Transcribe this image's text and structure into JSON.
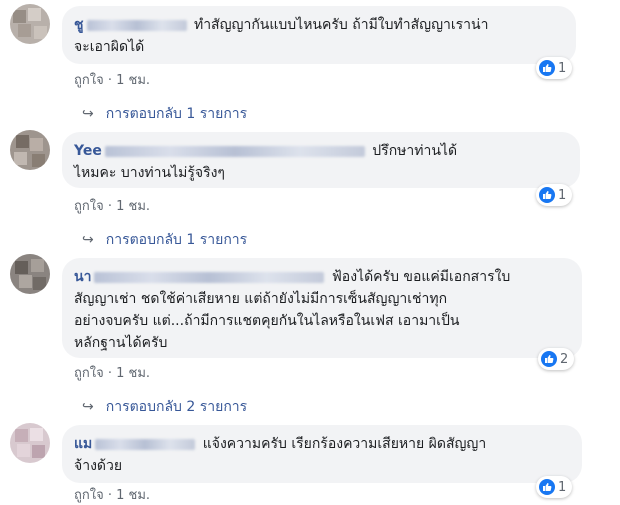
{
  "comments": [
    {
      "name": "ชู",
      "text": "ทำสัญญากันแบบไหนครับ ถ้ามีใบทำสัญญาเราน่าจะเอาผิดได้",
      "line1": "ทำสัญญากันแบบไหนครับ ถ้ามีใบทำสัญญาเราน่า",
      "line2": "จะเอาผิดได้",
      "like_label": "ถูกใจ",
      "time": "1 ชม.",
      "reaction_count": "1",
      "replies_label": "การตอบกลับ 1 รายการ"
    },
    {
      "name": "Yee",
      "line1": "ปรึกษาท่านได้",
      "line2": "ไหมคะ บางท่านไม่รู้จริงๆ",
      "like_label": "ถูกใจ",
      "time": "1 ชม.",
      "reaction_count": "1",
      "replies_label": "การตอบกลับ 1 รายการ"
    },
    {
      "name": "นา",
      "line1": "ฟ้องได้ครับ ขอแค่มีเอกสารใบ",
      "line2": "สัญญาเช่า ชดใช้ค่าเสียหาย แต่ถ้ายังไม่มีการเซ็นสัญญาเช่าทุก",
      "line3": "อย่างจบครับ แต่...ถ้ามีการแชตคุยกันในไลหรือในเฟส เอามาเป็น",
      "line4": "หลักฐานได้ครับ",
      "like_label": "ถูกใจ",
      "time": "1 ชม.",
      "reaction_count": "2",
      "replies_label": "การตอบกลับ 2 รายการ"
    },
    {
      "name": "แม",
      "line1": "แจ้งความครับ เรียกร้องความเสียหาย ผิดสัญญา",
      "line2": "จ้างด้วย",
      "like_label": "ถูกใจ",
      "time": "1 ชม.",
      "reaction_count": "1"
    }
  ],
  "colors": {
    "name": "#385898",
    "bubble": "#f2f3f5",
    "like_blue": "#1877f2",
    "meta": "#606770"
  },
  "icons": {
    "reaction": "thumbs-up-icon",
    "reply_arrow": "reply-arrow-icon"
  }
}
